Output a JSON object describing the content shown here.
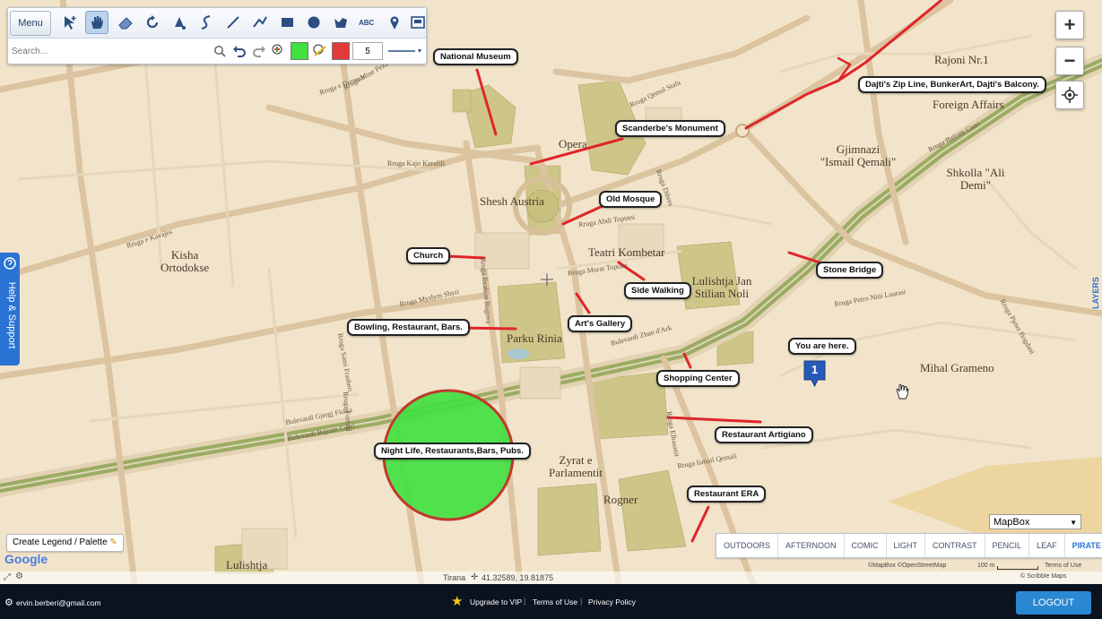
{
  "toolbar": {
    "menu_label": "Menu",
    "tools": [
      "select-icon",
      "pan-hand-icon",
      "eraser-icon",
      "rotate-icon",
      "fill-icon",
      "freehand-icon",
      "line-icon",
      "polyline-icon",
      "rectangle-icon",
      "circle-icon",
      "polygon-icon",
      "text-icon",
      "marker-icon",
      "image-icon"
    ],
    "search_placeholder": "Search...",
    "line_width": "5"
  },
  "map": {
    "districts": [
      "Kisha\nOrtodokse",
      "Parku Rinia",
      "Shesh Austria",
      "Teatri Kombetar",
      "Lulishtja Jan\nStilian Noli",
      "Mihal Grameno",
      "Gjimnazi\n\"Ismail Qemali\"",
      "Shkolla \"Ali\nDemi\"",
      "Rajoni Nr.1",
      "Foreign Affairs",
      "Opera",
      "Zyrat e\nParlamentit",
      "Rogner",
      "Lulishtja"
    ],
    "streets": [
      "Rruga e Durresit",
      "Rruga e Kavajes",
      "Rruga Mine Peza",
      "Rruga Fortuzi",
      "Rruga Sami Frasheri",
      "Bulevardi Zhan d'Ark",
      "Bulevardi Bajram Curri",
      "Bulevardi Gjergj Fishta",
      "Rruga Ibrahim Rugova",
      "Rruga Murat Toptani",
      "Rruga Abdi Toptani",
      "Rruga Dibres",
      "Rruga Elbasanit",
      "Rruga Petro Nini Luarasi",
      "Rruga Ismail Qemali",
      "Rruga Pjeter Bogdani",
      "Rruga Qemal Stafa",
      "Rruga Kajo Karafili",
      "Rruga Myslym Shyri",
      "Rruga Bajram Curri"
    ],
    "callouts": [
      "National Museum",
      "Scanderbe's Monument",
      "Dajti's Zip Line, BunkerArt, Dajti's Balcony.",
      "Old Mosque",
      "Church",
      "Stone Bridge",
      "Side Walking",
      "Art's Gallery",
      "Bowling, Restaurant, Bars.",
      "You are here.",
      "Shopping Center",
      "Restaurant Artigiano",
      "Night Life, Restaurants,Bars, Pubs.",
      "Restaurant ERA"
    ],
    "marker_number": "1",
    "circle_color": "#3fe03f",
    "route_color": "#e0252a"
  },
  "controls": {
    "zoom_in": "+",
    "zoom_out": "−",
    "help_label": "Help & Support",
    "layers_label": "LAYERS",
    "legend_button": "Create Legend / Palette",
    "provider_select": "MapBox",
    "styles": [
      "OUTDOORS",
      "AFTERNOON",
      "COMIC",
      "LIGHT",
      "CONTRAST",
      "PENCIL",
      "LEAF",
      "PIRATE"
    ],
    "selected_style": "PIRATE"
  },
  "map_footer": {
    "google": "Google",
    "location": "Tirana",
    "coords": "41.32589, 19.81875",
    "attribution": "©MapBox ©OpenStreetMap",
    "scale": "100 m",
    "terms": "Terms of Use",
    "brand": "© Scribble Maps"
  },
  "bottom_bar": {
    "email": "ervin.berberi@gmail.com",
    "upgrade": "Upgrade to VIP",
    "terms": "Terms of Use",
    "privacy": "Privacy Policy",
    "logout": "LOGOUT"
  }
}
